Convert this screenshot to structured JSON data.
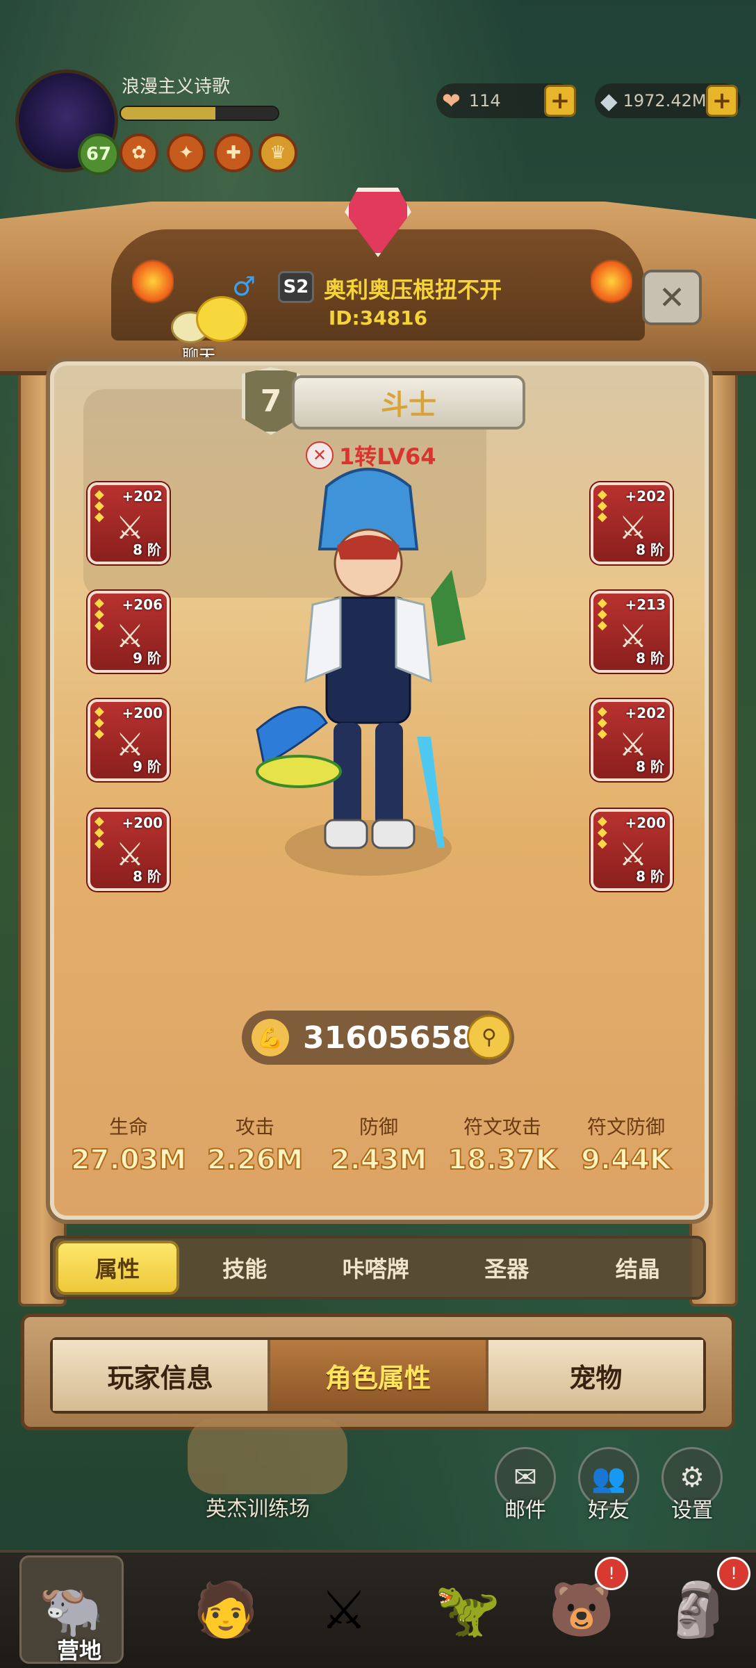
{
  "player": {
    "name": "浪漫主义诗歌",
    "level": "67",
    "exp_fraction": 0.6
  },
  "currency": {
    "gems": "114",
    "silver": "1972.42M"
  },
  "header": {
    "gender_symbol": "♂",
    "season": "S2",
    "target_name": "奥利奥压根扭不开",
    "target_id": "ID:34816",
    "chat_label": "聊天"
  },
  "character": {
    "rank": "7",
    "class_name": "斗士",
    "rebirth_level": "1转LV64"
  },
  "equipment_left": [
    {
      "plus": "+202",
      "tier": "8 阶",
      "icon": "sword-icon"
    },
    {
      "plus": "+206",
      "tier": "9 阶",
      "icon": "bow-icon"
    },
    {
      "plus": "+200",
      "tier": "9 阶",
      "icon": "armor-icon"
    },
    {
      "plus": "+200",
      "tier": "8 阶",
      "icon": "bracelet-icon"
    }
  ],
  "equipment_right": [
    {
      "plus": "+202",
      "tier": "8 阶",
      "icon": "sword-icon"
    },
    {
      "plus": "+213",
      "tier": "8 阶",
      "icon": "tiger-mask-icon"
    },
    {
      "plus": "+202",
      "tier": "8 阶",
      "icon": "armor-icon"
    },
    {
      "plus": "+200",
      "tier": "8 阶",
      "icon": "necklace-icon"
    }
  ],
  "power": {
    "value": "31605658"
  },
  "stats": [
    {
      "label": "生命",
      "value": "27.03M"
    },
    {
      "label": "攻击",
      "value": "2.26M"
    },
    {
      "label": "防御",
      "value": "2.43M"
    },
    {
      "label": "符文攻击",
      "value": "18.37K"
    },
    {
      "label": "符文防御",
      "value": "9.44K"
    }
  ],
  "sub_tabs": [
    "属性",
    "技能",
    "咔嗒牌",
    "圣器",
    "结晶"
  ],
  "main_tabs": [
    "玩家信息",
    "角色属性",
    "宠物"
  ],
  "world": {
    "camp_label": "英杰训练场",
    "mail_label": "邮件",
    "friends_label": "好友",
    "settings_label": "设置"
  },
  "nav": {
    "home_label": "营地"
  },
  "colors": {
    "gold_text": "#f5d33b",
    "equip_red": "#b8322f",
    "active_tab": "#fde66b"
  }
}
